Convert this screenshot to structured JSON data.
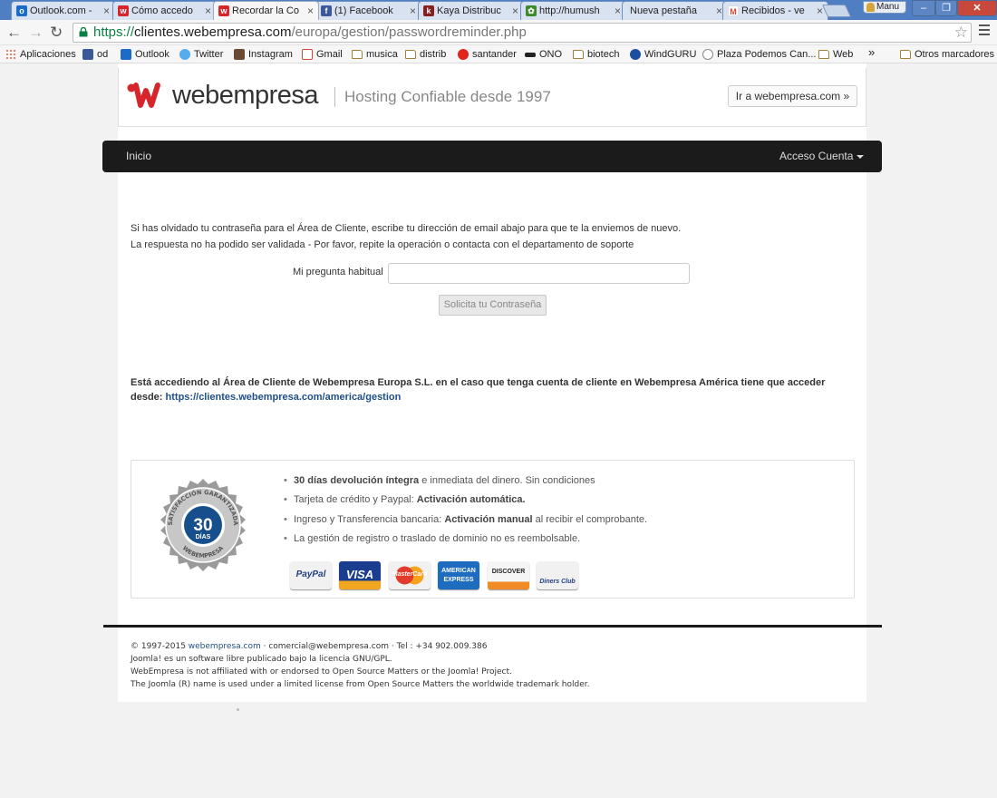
{
  "browser": {
    "tabs": [
      {
        "title": "Outlook.com -",
        "favicon": "outlook-icon",
        "color": "#1b6cc7"
      },
      {
        "title": "Cómo accedo",
        "favicon": "webempresa-icon",
        "color": "#d7262b"
      },
      {
        "title": "Recordar la Co",
        "favicon": "webempresa-icon",
        "color": "#d7262b"
      },
      {
        "title": "(1) Facebook",
        "favicon": "facebook-icon",
        "color": "#3b5998"
      },
      {
        "title": "Kaya Distribuc",
        "favicon": "kaya-icon",
        "color": "#8a1d1d"
      },
      {
        "title": "http://humush",
        "favicon": "leaf-icon",
        "color": "#3c8a2e"
      },
      {
        "title": "Nueva pestaña",
        "favicon": "blank-icon",
        "color": "#d8e2f0"
      },
      {
        "title": "Recibidos - ve",
        "favicon": "gmail-icon",
        "color": "#d14836"
      }
    ],
    "user_label": "Manu",
    "url_scheme": "https://",
    "url_host": "clientes.webempresa.com",
    "url_path": "/europa/gestion/passwordreminder.php",
    "bookmarks": [
      {
        "label": "Aplicaciones",
        "icon": "apps-grid-icon"
      },
      {
        "label": "od",
        "icon": "facebook-icon"
      },
      {
        "label": "Outlook",
        "icon": "outlook-icon"
      },
      {
        "label": "Twitter",
        "icon": "twitter-icon"
      },
      {
        "label": "Instagram",
        "icon": "instagram-icon"
      },
      {
        "label": "Gmail",
        "icon": "gmail-icon"
      },
      {
        "label": "musica",
        "icon": "folder-icon"
      },
      {
        "label": "distrib",
        "icon": "folder-icon"
      },
      {
        "label": "santander",
        "icon": "santander-icon"
      },
      {
        "label": "ONO",
        "icon": "ono-icon"
      },
      {
        "label": "biotech",
        "icon": "folder-icon"
      },
      {
        "label": "WindGURU",
        "icon": "windguru-icon"
      },
      {
        "label": "Plaza Podemos Can...",
        "icon": "podemos-icon"
      },
      {
        "label": "Web",
        "icon": "folder-icon"
      }
    ],
    "bookmarks_overflow": "»",
    "other_bookmarks": "Otros marcadores"
  },
  "header": {
    "brand": "webempresa",
    "tagline": "Hosting Confiable desde 1997",
    "goto_button": "Ir a webempresa.com »"
  },
  "nav": {
    "home": "Inicio",
    "account": "Acceso Cuenta"
  },
  "form": {
    "intro": "Si has olvidado tu contraseña para el Área de Cliente, escribe tu dirección de email abajo para que te la enviemos de nuevo.",
    "error": "La respuesta no ha podido ser validada - Por favor, repite la operación o contacta con el departamento de soporte",
    "question_label": "Mi pregunta habitual",
    "question_value": "",
    "submit": "Solicita tu Contraseña"
  },
  "notice": {
    "text": "Está accediendo al Área de Cliente de Webempresa Europa S.L. en el caso que tenga cuenta de cliente en Webempresa América tiene que acceder desde:",
    "link": "https://clientes.webempresa.com/america/gestion"
  },
  "guarantee": {
    "badge_top": "SATISFACCIÓN GARANTIZADA",
    "badge_bottom": "WEBEMPRESA",
    "badge_number": "30",
    "badge_days": "DÍAS",
    "items": [
      {
        "strong": "30 días devolución íntegra",
        "rest": " e inmediata del dinero. Sin condiciones"
      },
      {
        "pre": "Tarjeta de crédito y Paypal: ",
        "strong": "Activación automática."
      },
      {
        "pre": "Ingreso y Transferencia bancaria: ",
        "strong": "Activación manual",
        "rest": " al recibir el comprobante."
      },
      {
        "pre": "La gestión de registro o traslado de dominio no es reembolsable."
      }
    ],
    "payments": [
      "PayPal",
      "VISA",
      "MasterCard",
      "AMERICAN EXPRESS",
      "DISCOVER",
      "Diners Club"
    ]
  },
  "footer": {
    "copyright": "© 1997-2015 ",
    "site_link": "webempresa.com",
    "contact": " · comercial@webempresa.com · Tel : +34 902.009.386",
    "line2": "Joomla! es un software libre publicado bajo la licencia GNU/GPL.",
    "line3": "WebEmpresa is not affiliated with or endorsed to Open Source Matters or the Joomla! Project.",
    "line4": "The Joomla (R) name is used under a limited license from Open Source Matters the worldwide trademark holder."
  }
}
